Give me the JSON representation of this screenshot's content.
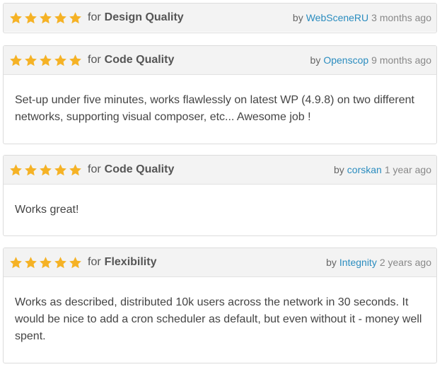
{
  "labels": {
    "for": "for",
    "by": "by"
  },
  "colors": {
    "star": "#f5b225",
    "author_link": "#2a8cbf",
    "header_bg": "#f3f3f3",
    "border": "#dcdcdc"
  },
  "reviews": [
    {
      "rating": 5,
      "category": "Design Quality",
      "author": "WebSceneRU",
      "time": "3 months ago",
      "text": ""
    },
    {
      "rating": 5,
      "category": "Code Quality",
      "author": "Openscop",
      "time": "9 months ago",
      "text": "Set-up under five minutes, works flawlessly on latest WP (4.9.8) on two different networks, supporting visual composer, etc... Awesome job !"
    },
    {
      "rating": 5,
      "category": "Code Quality",
      "author": "corskan",
      "time": "1 year ago",
      "text": "Works great!"
    },
    {
      "rating": 5,
      "category": "Flexibility",
      "author": "Integnity",
      "time": "2 years ago",
      "text": "Works as described, distributed 10k users across the network in 30 seconds. It would be nice to add a cron scheduler as default, but even without it - money well spent."
    }
  ]
}
